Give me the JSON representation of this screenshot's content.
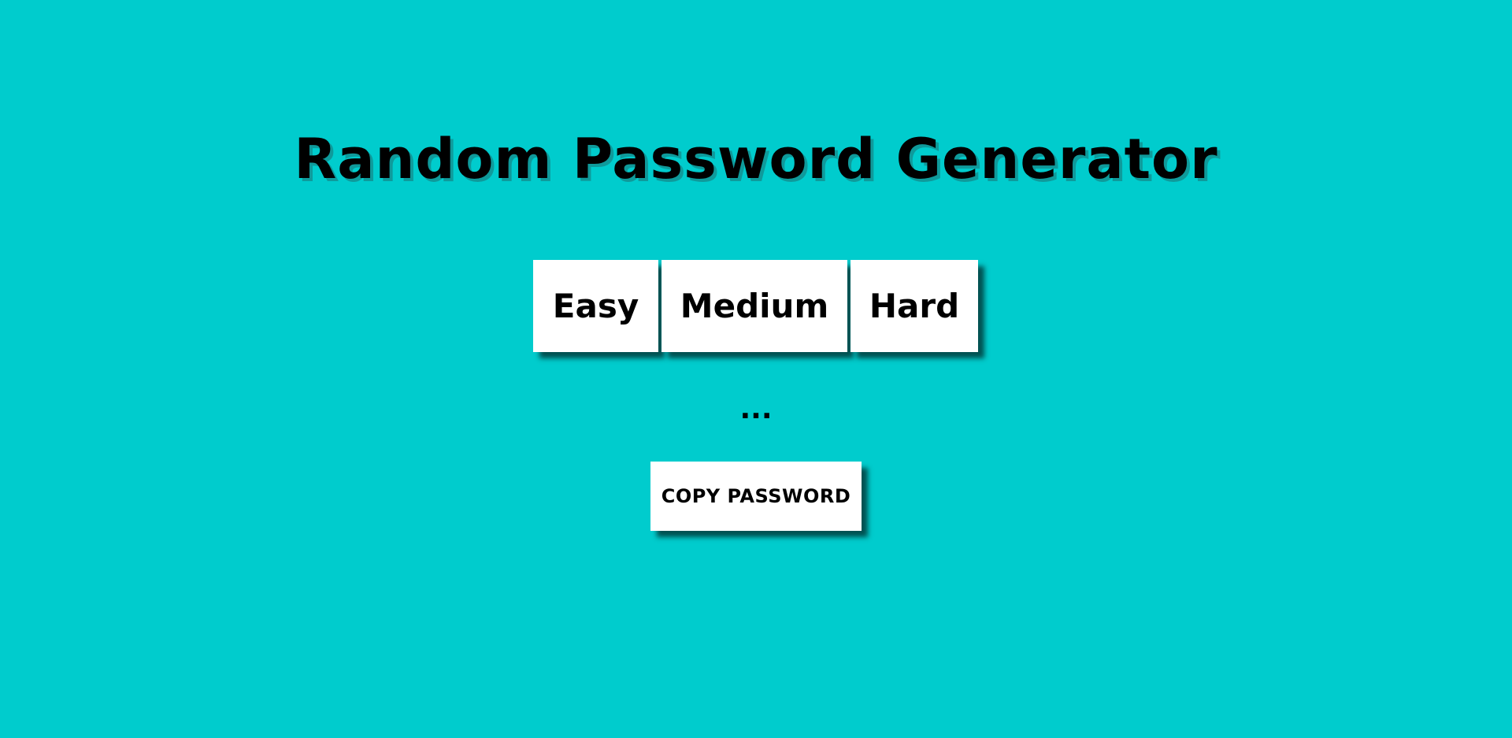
{
  "header": {
    "title": "Random Password Generator"
  },
  "difficulty": {
    "options": [
      {
        "label": "Easy"
      },
      {
        "label": "Medium"
      },
      {
        "label": "Hard"
      }
    ]
  },
  "password": {
    "value": "..."
  },
  "actions": {
    "copy_label": "COPY PASSWORD"
  },
  "colors": {
    "background": "#00cccd",
    "button": "#ffffff",
    "text": "#000000"
  }
}
